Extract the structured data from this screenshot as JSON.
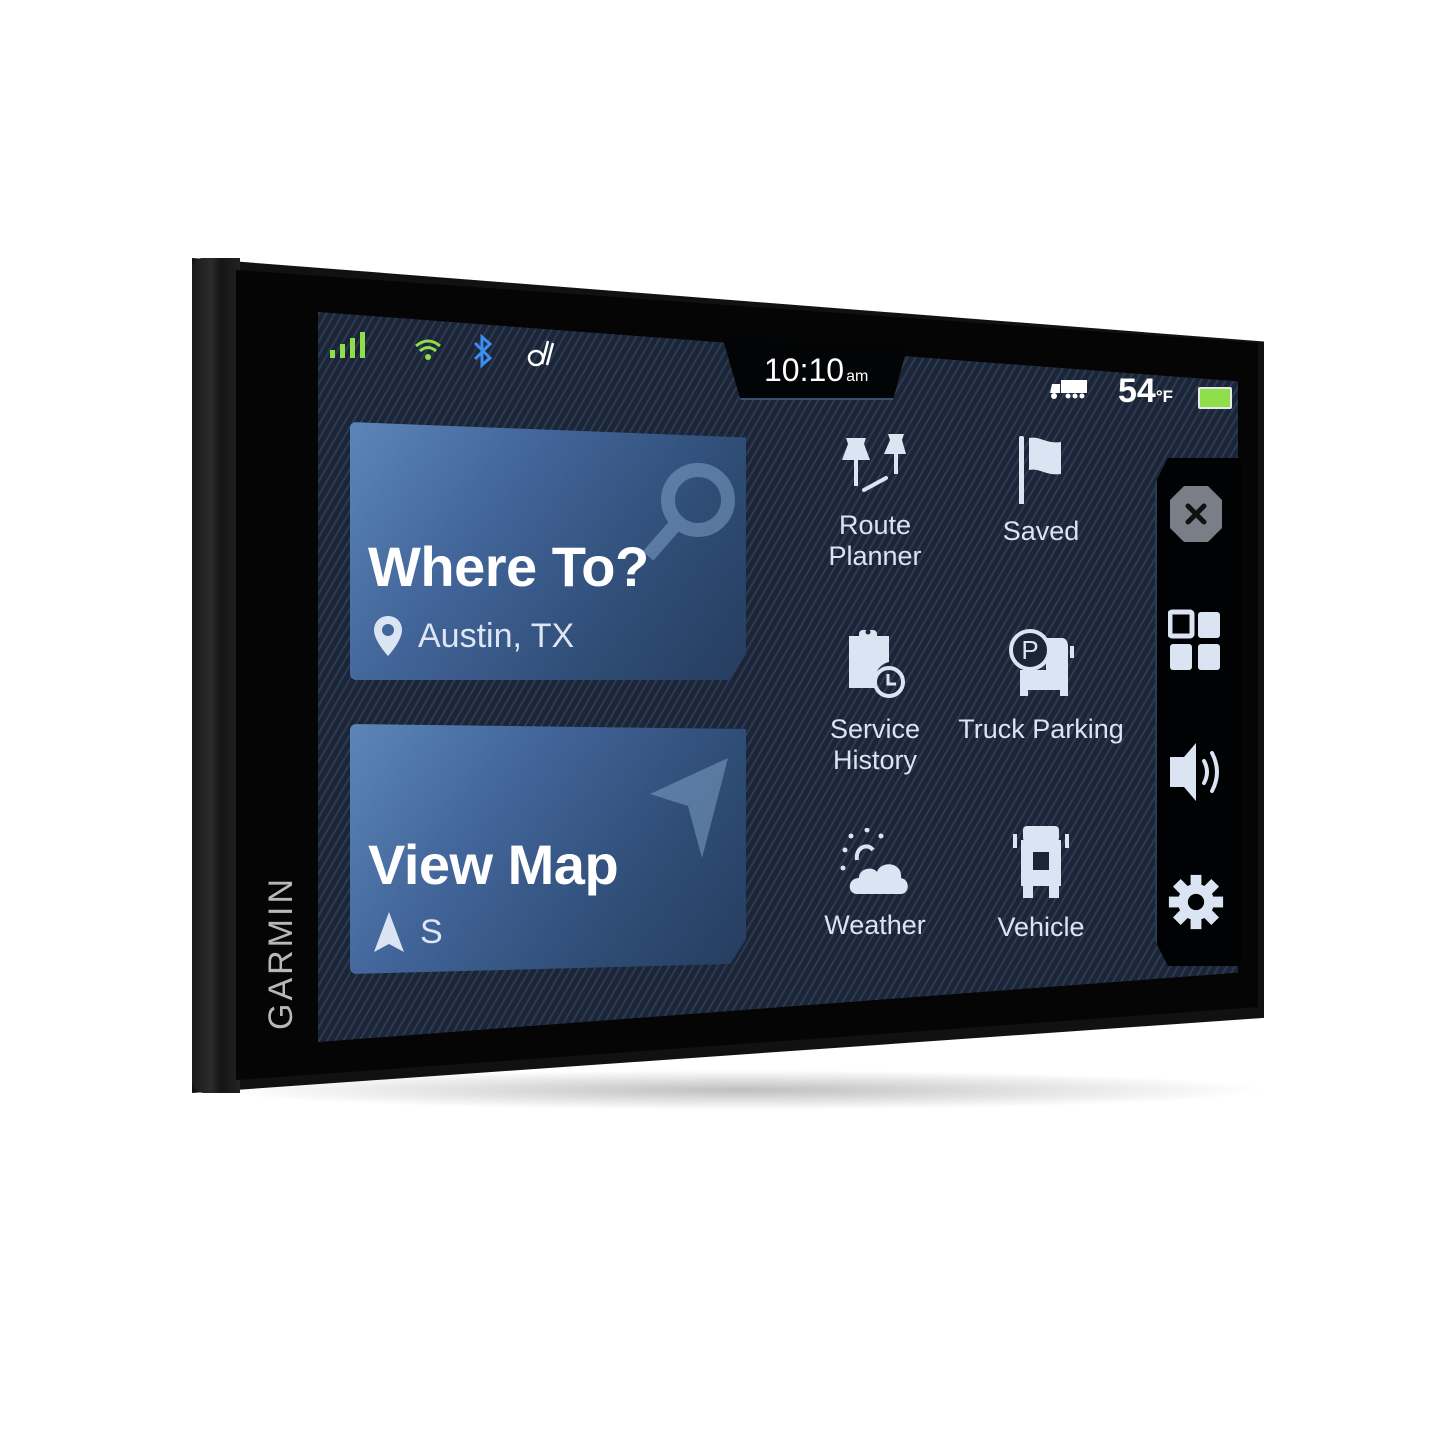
{
  "device": {
    "brand": "GARMIN"
  },
  "status_bar": {
    "icons": [
      "cellular-signal-icon",
      "wifi-icon",
      "bluetooth-icon",
      "drive-link-icon",
      "truck-mode-icon",
      "battery-icon"
    ],
    "time": "10:10",
    "time_suffix": "am",
    "temperature": "54",
    "temperature_unit": "°F",
    "colors": {
      "signal": "#8fdf4a",
      "bluetooth": "#3b8df0",
      "battery": "#8fdf4a"
    }
  },
  "main_cards": [
    {
      "title": "Where To?",
      "subtitle": "Austin, TX",
      "icon": "location-pin-icon",
      "bg_icon": "search-icon"
    },
    {
      "title": "View Map",
      "subtitle": "S",
      "icon": "heading-arrow-icon",
      "bg_icon": "navigation-arrow-icon"
    }
  ],
  "apps": [
    {
      "label": "Route Planner",
      "icon": "push-pins-icon"
    },
    {
      "label": "Saved",
      "icon": "flag-icon"
    },
    {
      "label": "Service History",
      "icon": "clipboard-clock-icon"
    },
    {
      "label": "Truck Parking",
      "icon": "truck-parking-icon"
    },
    {
      "label": "Weather",
      "icon": "weather-icon"
    },
    {
      "label": "Vehicle",
      "icon": "truck-icon"
    }
  ],
  "sidebar": {
    "buttons": [
      {
        "name": "close",
        "icon": "close-icon"
      },
      {
        "name": "apps",
        "icon": "grid-icon"
      },
      {
        "name": "volume",
        "icon": "speaker-icon"
      },
      {
        "name": "settings",
        "icon": "gear-icon"
      }
    ]
  },
  "colors": {
    "card_blue": "#42659a",
    "icon_light": "#dbe4f2"
  }
}
